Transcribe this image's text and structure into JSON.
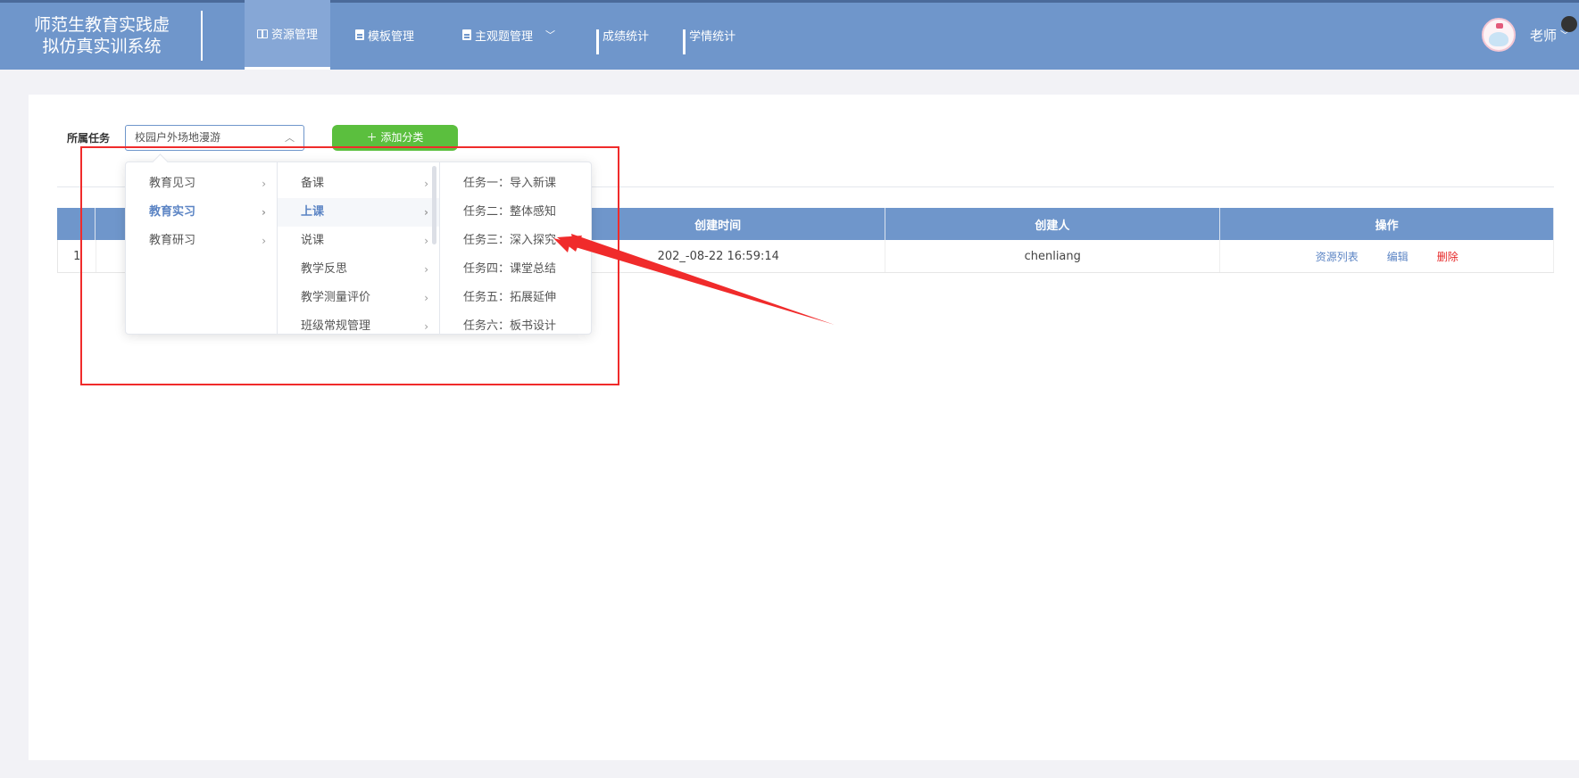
{
  "brand": {
    "line1": "师范生教育实践虚",
    "line2": "拟仿真实训系统"
  },
  "nav": {
    "items": [
      {
        "label": "资源管理",
        "icon": "book-icon",
        "active": true
      },
      {
        "label": "模板管理",
        "icon": "document-icon"
      },
      {
        "label": "主观题管理",
        "icon": "document-icon",
        "has_dropdown": true
      },
      {
        "label": "成绩统计",
        "icon": "bar-chart-icon"
      },
      {
        "label": "学情统计",
        "icon": "bar-chart-icon"
      }
    ]
  },
  "user": {
    "name": "老师"
  },
  "filter": {
    "label": "所属任务",
    "selected": "校园户外场地漫游",
    "add_button": "添加分类"
  },
  "cascader": {
    "level1": [
      "教育见习",
      "教育实习",
      "教育研习"
    ],
    "level1_active": "教育实习",
    "level2": [
      "备课",
      "上课",
      "说课",
      "教学反思",
      "教学测量评价",
      "班级常规管理"
    ],
    "level2_active": "上课",
    "level3": [
      "任务一：导入新课",
      "任务二：整体感知",
      "任务三：深入探究",
      "任务四：课堂总结",
      "任务五：拓展延伸",
      "任务六：板书设计"
    ]
  },
  "table": {
    "headers": {
      "index": "",
      "name": "",
      "created_time": "创建时间",
      "creator": "创建人",
      "actions": "操作"
    },
    "rows": [
      {
        "index": "1",
        "name": "",
        "created_time": "202_-08-22 16:59:14",
        "creator": "chenliang",
        "actions": {
          "list": "资源列表",
          "edit": "编辑",
          "delete": "删除"
        }
      }
    ]
  },
  "colors": {
    "nav_bg": "#6f96cb",
    "accent": "#5b84c4",
    "success": "#5bbf3e",
    "danger": "#e62828",
    "annotation": "#f02b2b"
  }
}
